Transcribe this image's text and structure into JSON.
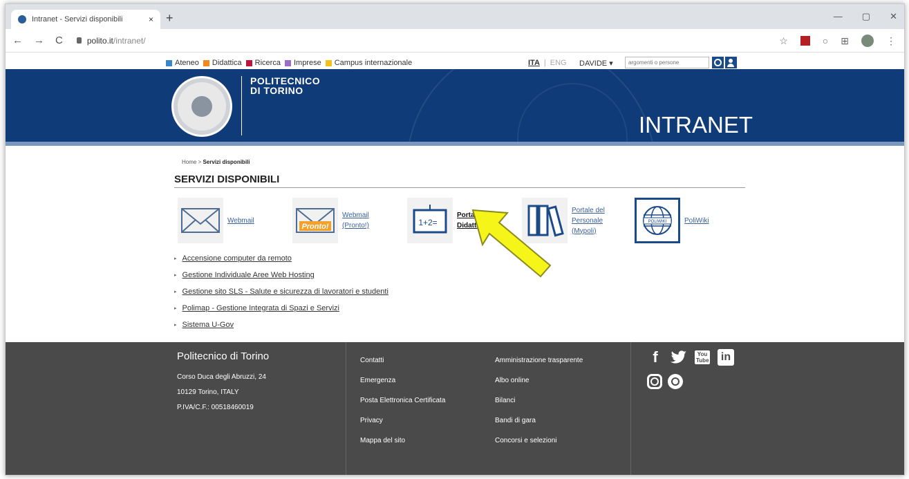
{
  "browser": {
    "tab_title": "Intranet - Servizi disponibili",
    "tab_close": "×",
    "new_tab": "+",
    "window_controls": [
      "—",
      "▢",
      "✕"
    ],
    "nav": {
      "back": "←",
      "forward": "→",
      "reload": "C"
    },
    "url_host": "polito.it",
    "url_path": "/intranet/",
    "star": "☆"
  },
  "topbar": {
    "menu": [
      {
        "label": "Ateneo",
        "color": "#3a86c8"
      },
      {
        "label": "Didattica",
        "color": "#f08a1c"
      },
      {
        "label": "Ricerca",
        "color": "#c0143c"
      },
      {
        "label": "Imprese",
        "color": "#9b6fc4"
      },
      {
        "label": "Campus internazionale",
        "color": "#f2c21a"
      }
    ],
    "lang_ita": "ITA",
    "lang_sep": "|",
    "lang_eng": "ENG",
    "user": "DAVIDE ▾",
    "search_placeholder": "argomenti o persone"
  },
  "banner": {
    "logo_line1": "POLITECNICO",
    "logo_line2": "DI TORINO",
    "section": "INTRANET"
  },
  "breadcrumb": {
    "home": "Home",
    "sep": " > ",
    "current": "Servizi disponibili"
  },
  "page_title": "SERVIZI DISPONIBILI",
  "services": [
    {
      "label": "Webmail"
    },
    {
      "label": "Webmail (Pronto!)",
      "icon_text": "Pronto!"
    },
    {
      "label": "Portale della Didattica",
      "icon_text": "1+2="
    },
    {
      "label": "Portale del Personale (Mypoli)"
    },
    {
      "label": "PoliWiki",
      "icon_text": "POLIWIKI"
    }
  ],
  "links": [
    "Accensione computer da remoto",
    "Gestione Individuale Aree Web Hosting",
    "Gestione sito SLS - Salute e sicurezza di lavoratori e studenti",
    "Polimap - Gestione Integrata di Spazi e Servizi",
    "Sistema U-Gov"
  ],
  "footer": {
    "name": "Politecnico di Torino",
    "address": [
      "Corso Duca degli Abruzzi, 24",
      "10129 Torino, ITALY",
      "P.IVA/C.F.: 00518460019"
    ],
    "col1": [
      "Contatti",
      "Emergenza",
      "Posta Elettronica Certificata",
      "Privacy",
      "Mappa del sito"
    ],
    "col2": [
      "Amministrazione trasparente",
      "Albo online",
      "Bilanci",
      "Bandi di gara",
      "Concorsi e selezioni"
    ],
    "social": [
      "facebook-icon",
      "twitter-icon",
      "youtube-icon",
      "linkedin-icon",
      "instagram-icon",
      "other-social-icon"
    ],
    "social_glyphs": {
      "facebook": "f",
      "twitter": "🐦",
      "youtube": "You Tube",
      "linkedin": "in"
    }
  },
  "annotation": {
    "color": "#f5f51a",
    "outline": "#8a8a20"
  }
}
